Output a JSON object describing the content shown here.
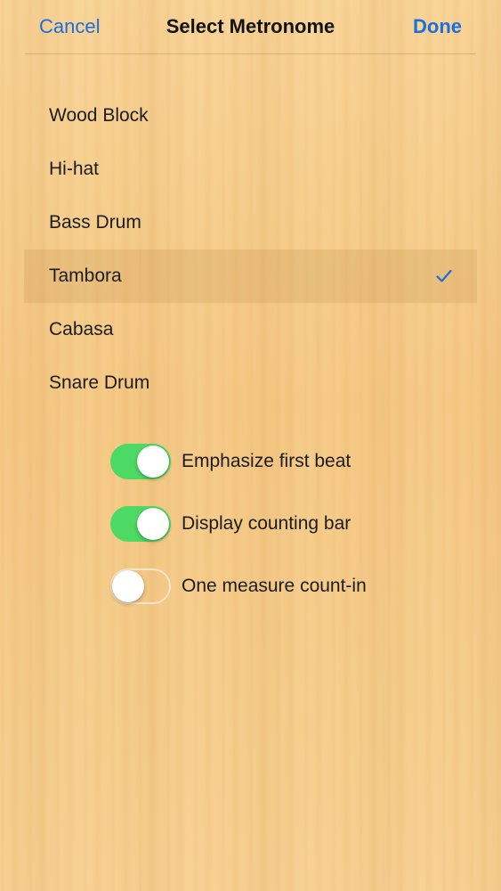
{
  "nav": {
    "cancel_label": "Cancel",
    "title": "Select Metronome",
    "done_label": "Done"
  },
  "sounds": [
    {
      "label": "Wood Block",
      "selected": false
    },
    {
      "label": "Hi-hat",
      "selected": false
    },
    {
      "label": "Bass Drum",
      "selected": false
    },
    {
      "label": "Tambora",
      "selected": true
    },
    {
      "label": "Cabasa",
      "selected": false
    },
    {
      "label": "Snare Drum",
      "selected": false
    }
  ],
  "options": [
    {
      "label": "Emphasize first beat",
      "on": true
    },
    {
      "label": "Display counting bar",
      "on": true
    },
    {
      "label": "One measure count-in",
      "on": false
    }
  ],
  "colors": {
    "accent": "#1a6fe0",
    "switch_on": "#4cd964",
    "background": "#f6cb86"
  },
  "icons": {
    "selected_marker": "checkmark-icon"
  }
}
